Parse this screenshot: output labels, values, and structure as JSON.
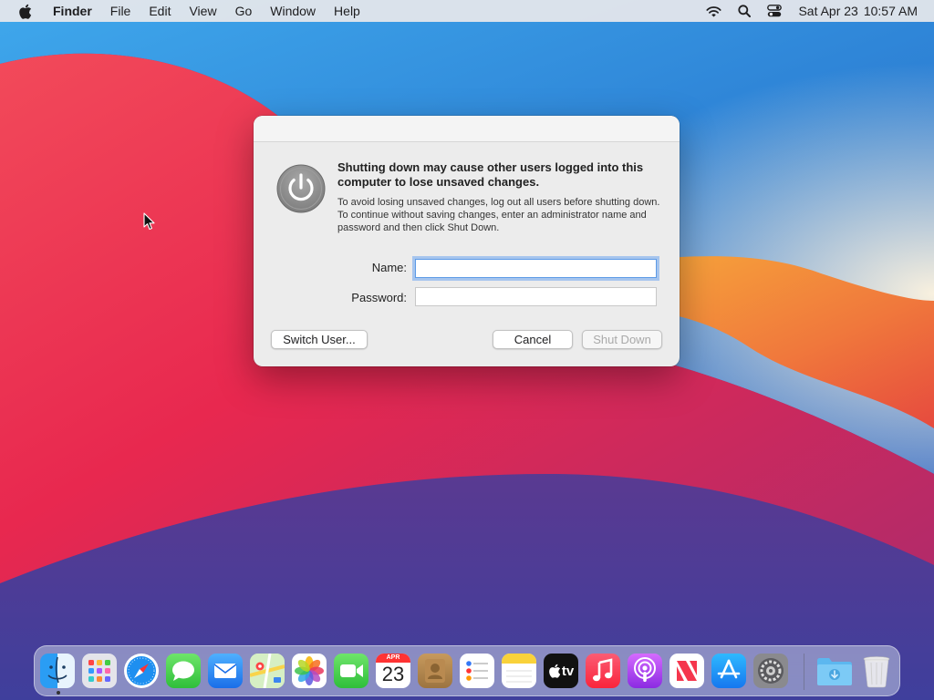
{
  "menubar": {
    "apple_icon": "apple-logo-icon",
    "app_name": "Finder",
    "menus": [
      "File",
      "Edit",
      "View",
      "Go",
      "Window",
      "Help"
    ],
    "status_icons": [
      "wifi-icon",
      "search-icon",
      "control-center-icon"
    ],
    "date": "Sat Apr 23",
    "time": "10:57 AM"
  },
  "dialog": {
    "icon": "power-icon",
    "title": "Shutting down may cause other users logged into this computer to lose unsaved changes.",
    "body": "To avoid losing unsaved changes, log out all users before shutting down. To continue without saving changes, enter an administrator name and password and then click Shut Down.",
    "name_label": "Name:",
    "name_value": "",
    "password_label": "Password:",
    "password_value": "",
    "switch_user_label": "Switch User...",
    "cancel_label": "Cancel",
    "shutdown_label": "Shut Down"
  },
  "dock": {
    "apps": [
      "Finder",
      "Launchpad",
      "Safari",
      "Messages",
      "Mail",
      "Maps",
      "Photos",
      "FaceTime",
      "Calendar",
      "Contacts",
      "Reminders",
      "Notes",
      "TV",
      "Music",
      "Podcasts",
      "News",
      "App Store",
      "System Preferences",
      "Downloads",
      "Trash"
    ],
    "calendar_month": "APR",
    "calendar_day": "23",
    "tv_label": "tv"
  },
  "colors": {
    "accent": "#5d9be6",
    "dialog_bg": "#ececec",
    "menubar_bg": "#e8e8ec"
  }
}
